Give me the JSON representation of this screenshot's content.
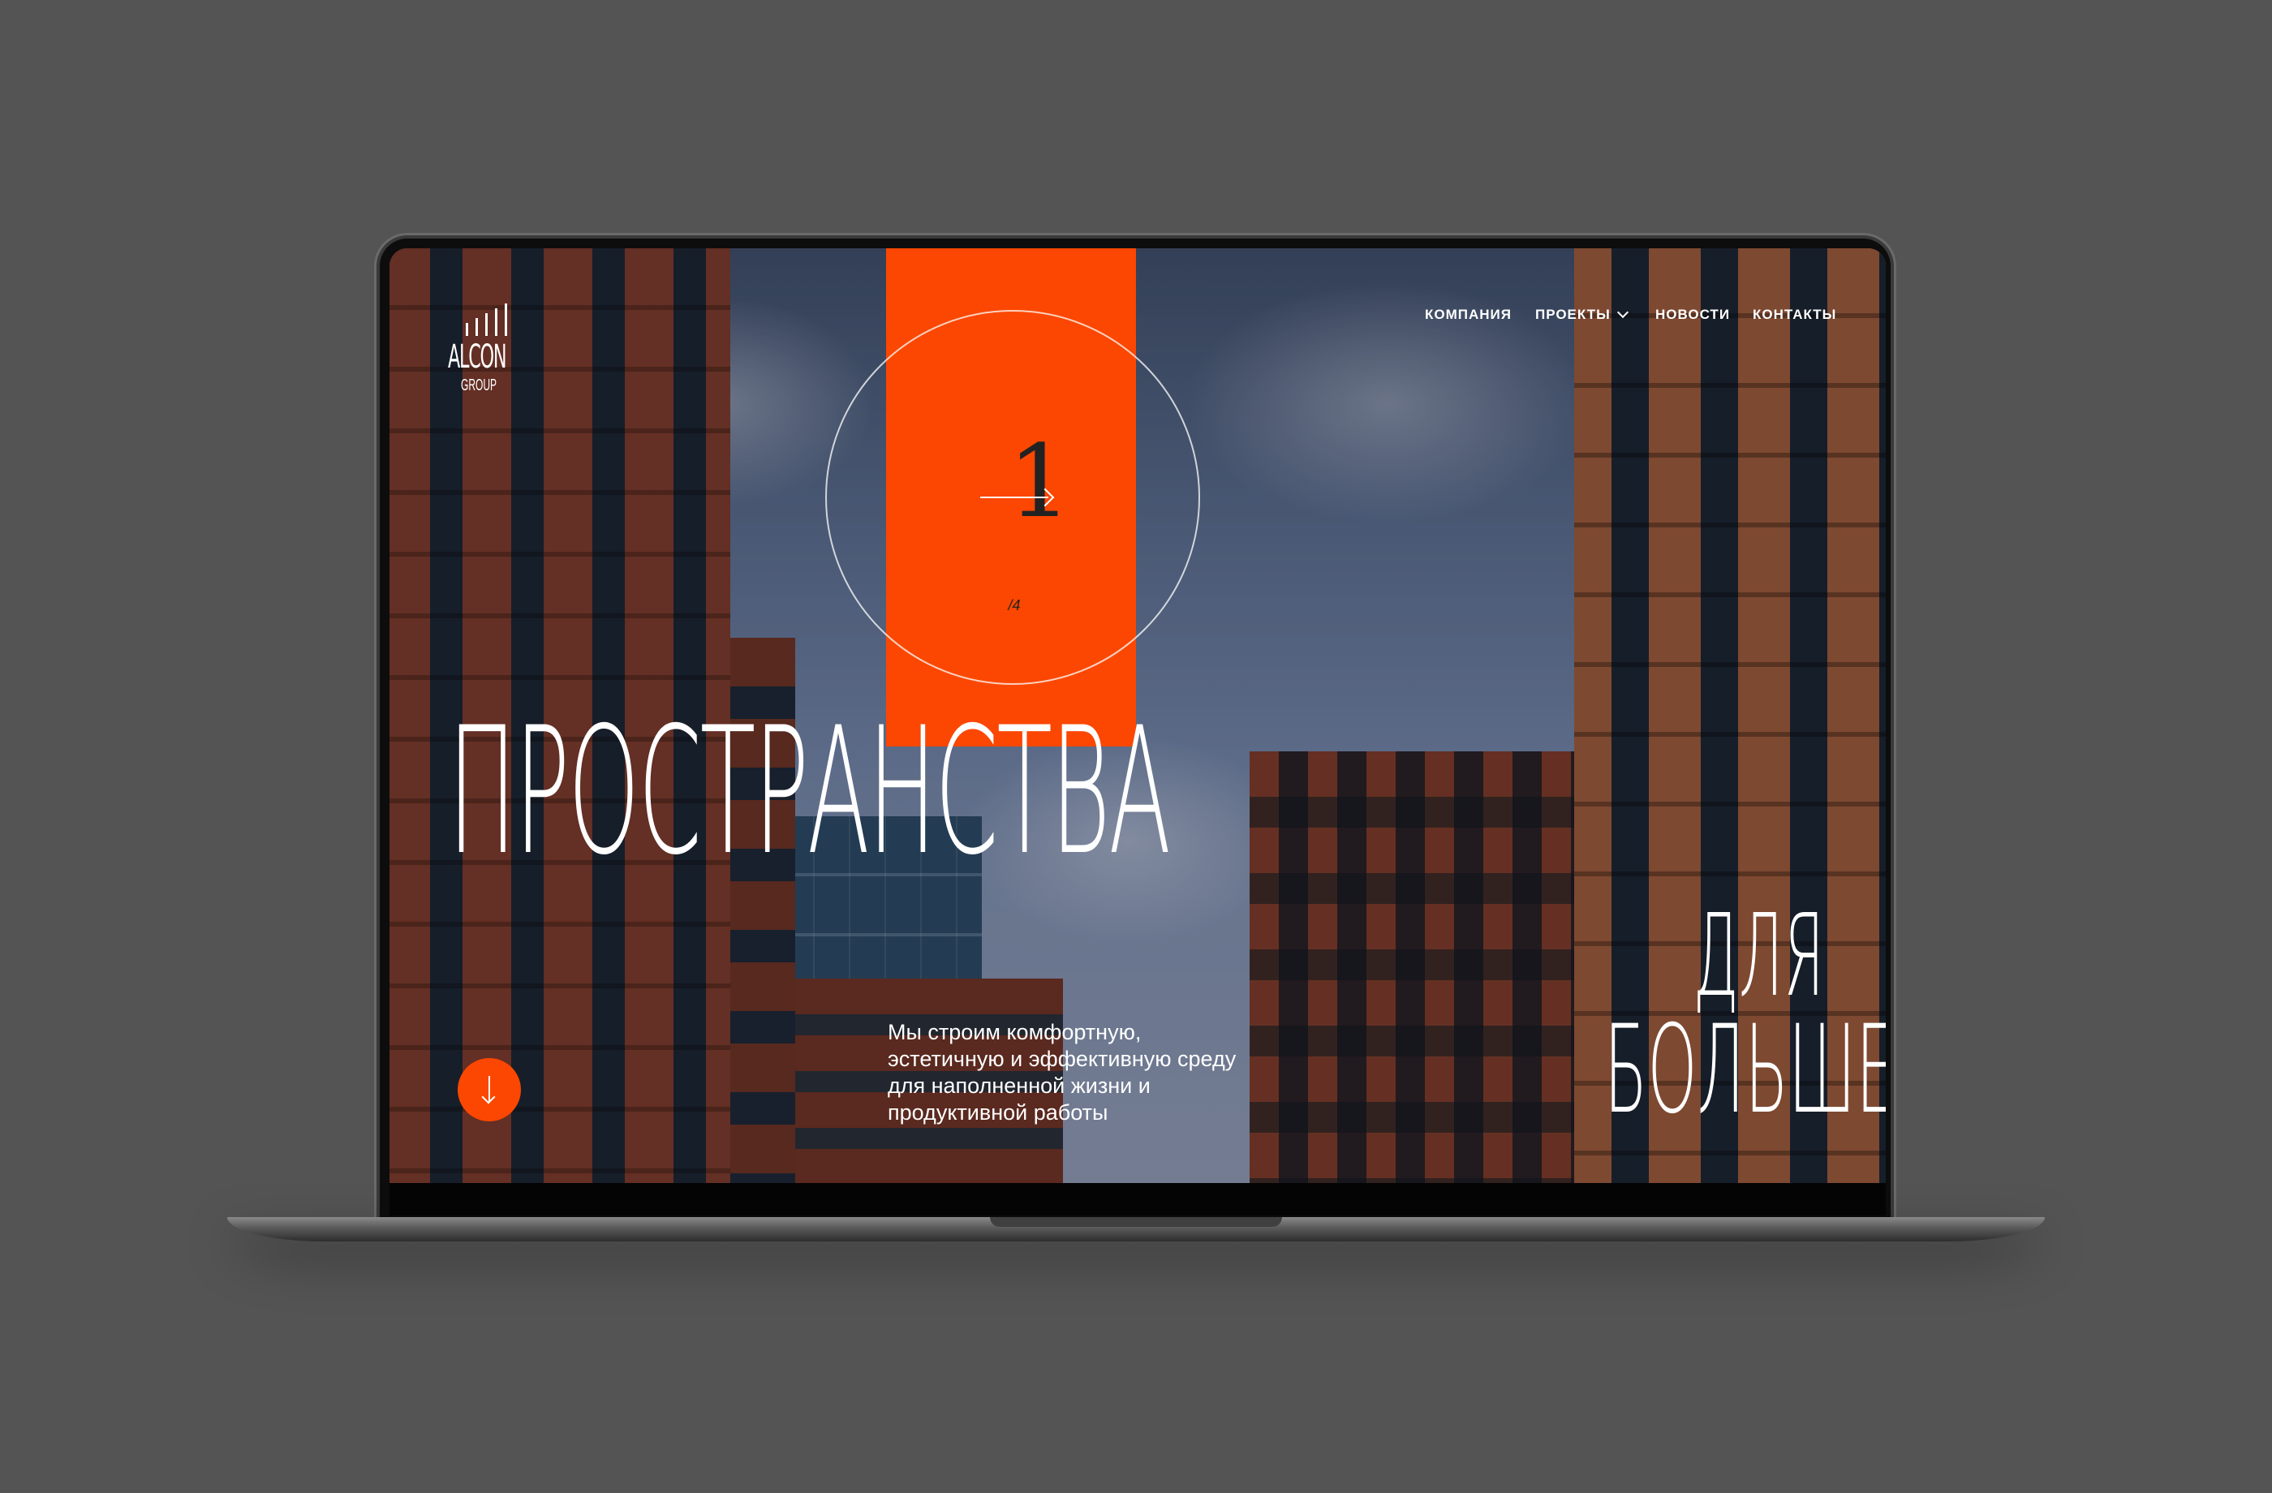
{
  "brand": {
    "name": "ALCON",
    "sub": "GROUP",
    "accent": "#fb4701"
  },
  "nav": {
    "items": [
      {
        "label": "КОМПАНИЯ"
      },
      {
        "label": "ПРОЕКТЫ"
      },
      {
        "label": "НОВОСТИ"
      },
      {
        "label": "КОНТАКТЫ"
      }
    ]
  },
  "slider": {
    "current": "1",
    "total": "/4"
  },
  "hero": {
    "headline_1": "ПРОСТРАНСТВА",
    "headline_2": "ДЛЯ",
    "headline_3": "БОЛЬШЕГО",
    "tagline": "Мы строим комфортную, эстетичную и эффективную среду для наполненной жизни и продуктивной работы"
  },
  "icons": {
    "scroll": "arrow-down-icon",
    "next": "arrow-right-icon",
    "dropdown": "chevron-down-icon"
  }
}
